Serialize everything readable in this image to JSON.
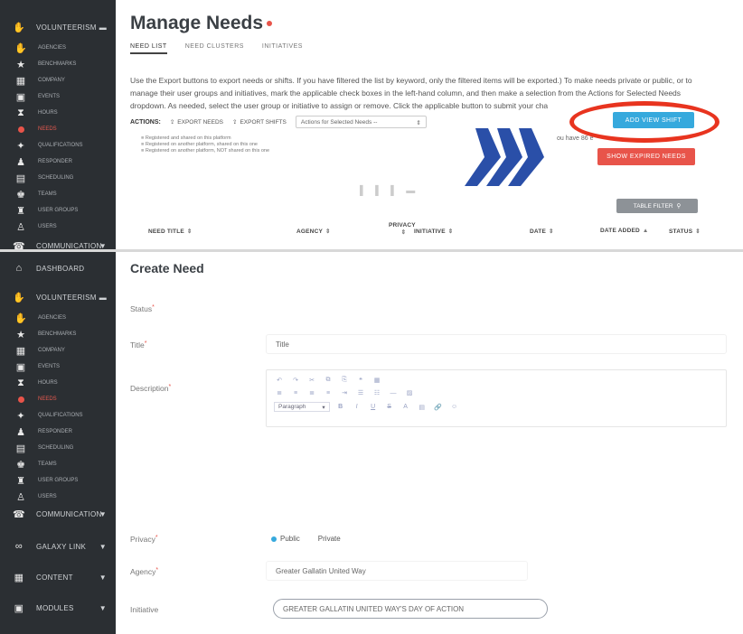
{
  "top_panel": {
    "sidebar": {
      "group_label": "VOLUNTEERISM",
      "items": [
        {
          "label": "AGENCIES",
          "icon": "handshake-icon"
        },
        {
          "label": "BENCHMARKS",
          "icon": "star-icon"
        },
        {
          "label": "COMPANY",
          "icon": "building-icon"
        },
        {
          "label": "EVENTS",
          "icon": "calendar-icon"
        },
        {
          "label": "HOURS",
          "icon": "hourglass-icon"
        },
        {
          "label": "NEEDS",
          "icon": "dot-icon",
          "active": true
        },
        {
          "label": "QUALIFICATIONS",
          "icon": "badge-icon"
        },
        {
          "label": "RESPONDER",
          "icon": "person-icon"
        },
        {
          "label": "SCHEDULING",
          "icon": "schedule-icon"
        },
        {
          "label": "TEAMS",
          "icon": "team-icon"
        },
        {
          "label": "USER GROUPS",
          "icon": "group-icon"
        },
        {
          "label": "USERS",
          "icon": "user-icon"
        }
      ],
      "footer_label": "COMMUNICATION"
    },
    "title": "Manage Needs",
    "tabs": [
      "NEED LIST",
      "NEED CLUSTERS",
      "INITIATIVES"
    ],
    "instructions": "Use the Export buttons to export needs or shifts. If you have filtered the list by keyword, only the filtered items will be exported.) To make needs private or public, or to manage their user groups and initiatives, mark the applicable check boxes in the left-hand column, and then make a selection from the Actions for Selected Needs dropdown. As needed, select the user group or initiative to assign or remove. Click the applicable button to submit your cha",
    "actions_label": "ACTIONS:",
    "export_needs": "EXPORT NEEDS",
    "export_shifts": "EXPORT SHIFTS",
    "actions_select": "Actions for Selected Needs --",
    "legend": [
      "Registered and shared on this platform",
      "Registered on another platform, shared on this one",
      "Registered on another platform, NOT shared on this one"
    ],
    "hidden_text": "ou have 86 e",
    "add_view_btn": "ADD VIEW SHIFT",
    "show_expired_btn": "SHOW EXPIRED NEEDS",
    "table_filter_btn": "TABLE FILTER",
    "columns": [
      "NEED TITLE",
      "AGENCY",
      "PRIVACY",
      "INITIATIVE",
      "DATE",
      "DATE ADDED",
      "STATUS"
    ],
    "accent_blue": "#36a9dd",
    "accent_red": "#e8544a"
  },
  "bottom_panel": {
    "sidebar": {
      "dashboard": "DASHBOARD",
      "group_label": "VOLUNTEERISM",
      "items": [
        {
          "label": "AGENCIES",
          "icon": "handshake-icon"
        },
        {
          "label": "BENCHMARKS",
          "icon": "star-icon"
        },
        {
          "label": "COMPANY",
          "icon": "building-icon"
        },
        {
          "label": "EVENTS",
          "icon": "calendar-icon"
        },
        {
          "label": "HOURS",
          "icon": "hourglass-icon"
        },
        {
          "label": "NEEDS",
          "icon": "dot-icon",
          "active": true
        },
        {
          "label": "QUALIFICATIONS",
          "icon": "badge-icon"
        },
        {
          "label": "RESPONDER",
          "icon": "person-icon"
        },
        {
          "label": "SCHEDULING",
          "icon": "schedule-icon"
        },
        {
          "label": "TEAMS",
          "icon": "team-icon"
        },
        {
          "label": "USER GROUPS",
          "icon": "group-icon"
        },
        {
          "label": "USERS",
          "icon": "user-icon"
        }
      ],
      "communication": "COMMUNICATION",
      "galaxy_link": "GALAXY LINK",
      "content": "CONTENT",
      "modules": "MODULES"
    },
    "title": "Create Need",
    "status_label": "Status",
    "title_label": "Title",
    "title_placeholder": "Title",
    "description_label": "Description",
    "editor_format": "Paragraph",
    "privacy_label": "Privacy",
    "privacy_public": "Public",
    "privacy_private": "Private",
    "agency_label": "Agency",
    "agency_value": "Greater Gallatin United Way",
    "initiative_label": "Initiative",
    "initiative_value": "GREATER GALLATIN UNITED WAY'S DAY OF ACTION"
  }
}
